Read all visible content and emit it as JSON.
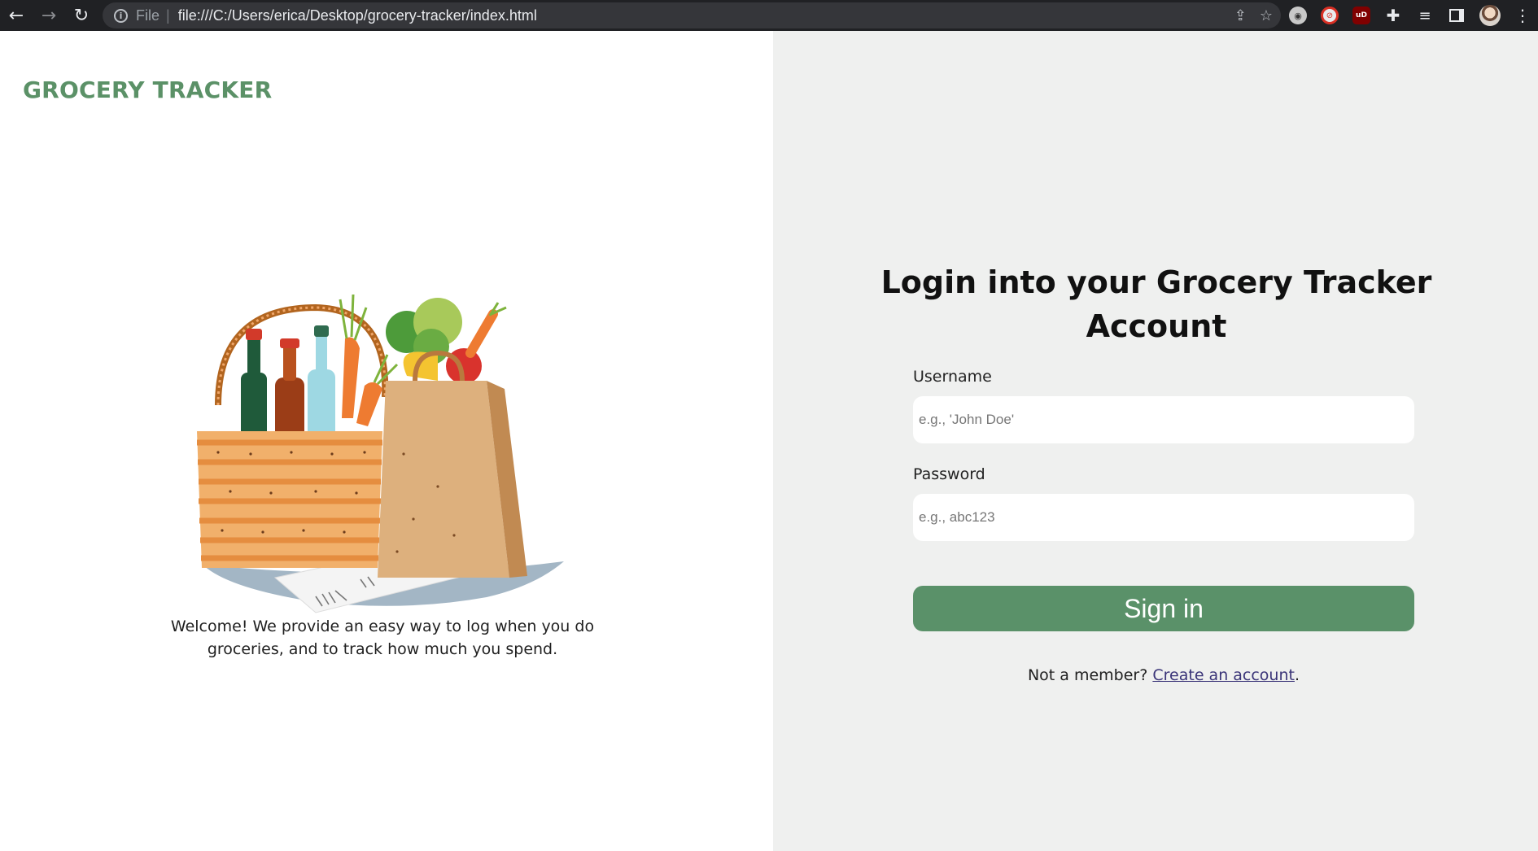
{
  "browser": {
    "back_icon": "arrow-left-icon",
    "forward_icon": "arrow-right-icon",
    "reload_icon": "reload-icon",
    "scheme_label": "File",
    "url": "file:///C:/Users/erica/Desktop/grocery-tracker/index.html"
  },
  "brand": {
    "name": "GROCERY TRACKER",
    "color": "#5b9167"
  },
  "hero": {
    "illustration": "grocery-basket-illustration",
    "welcome_text": "Welcome! We provide an easy way to log when you do groceries, and to track how much you spend."
  },
  "login": {
    "title": "Login into your Grocery Tracker Account",
    "username_label": "Username",
    "username_placeholder": "e.g., 'John Doe'",
    "username_value": "",
    "password_label": "Password",
    "password_placeholder": "e.g., abc123",
    "password_value": "",
    "signin_label": "Sign in",
    "signin_color": "#5a9169",
    "member_prompt": "Not a member? ",
    "create_link": "Create an account",
    "member_suffix": "."
  }
}
